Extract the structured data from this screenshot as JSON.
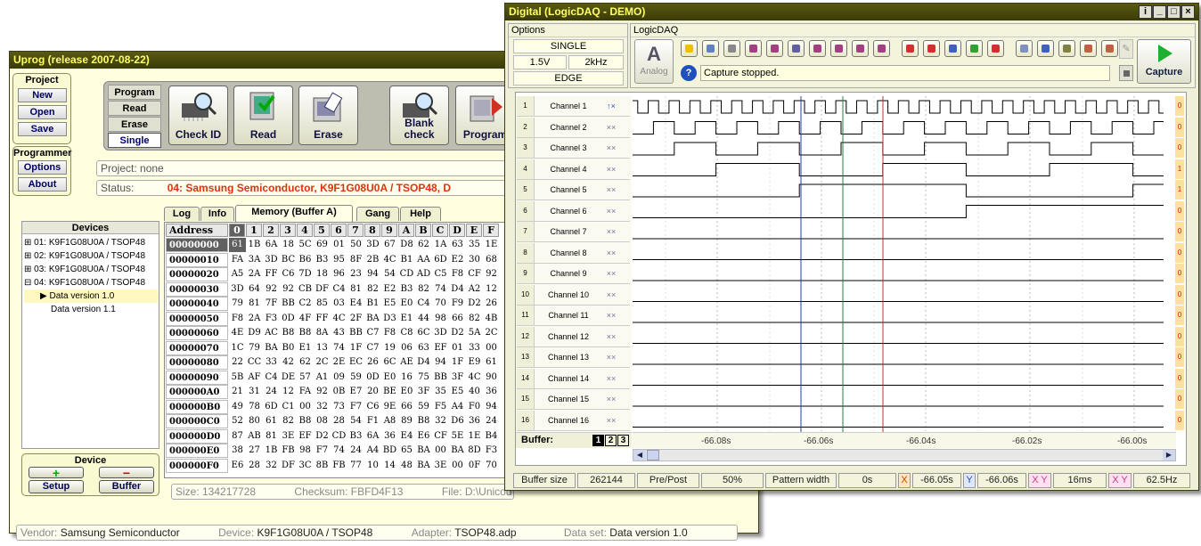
{
  "uprog": {
    "title": "Uprog (release 2007-08-22)",
    "project_group": "Project",
    "project_buttons": [
      "New",
      "Open",
      "Save"
    ],
    "programmer_group": "Programmer",
    "programmer_buttons": [
      "Options",
      "About"
    ],
    "mode_buttons": [
      "Program",
      "Read",
      "Erase",
      "Single"
    ],
    "big_buttons": [
      {
        "label": "Check ID",
        "icon": "chip-magnifier-icon"
      },
      {
        "label": "Read",
        "icon": "chip-read-icon"
      },
      {
        "label": "Erase",
        "icon": "chip-erase-icon"
      },
      {
        "label": "Blank check",
        "icon": "chip-blank-check-icon"
      },
      {
        "label": "Program",
        "icon": "chip-program-icon"
      }
    ],
    "project_field": "Project:  none",
    "status_label": "Status:",
    "status_value": "04: Samsung Semiconductor, K9F1G08U0A / TSOP48, D",
    "devices_title": "Devices",
    "devices": [
      "⊞ 01: K9F1G08U0A / TSOP48",
      "⊞ 02: K9F1G08U0A / TSOP48",
      "⊞ 03: K9F1G08U0A / TSOP48",
      "⊟ 04: K9F1G08U0A / TSOP48",
      "▶ Data version 1.0",
      "Data version 1.1"
    ],
    "tabs": [
      "Log",
      "Info",
      "Memory (Buffer A)",
      "Gang",
      "Help"
    ],
    "hex_header": [
      "Address",
      "0",
      "1",
      "2",
      "3",
      "4",
      "5",
      "6",
      "7",
      "8",
      "9",
      "A",
      "B",
      "C",
      "D",
      "E",
      "F"
    ],
    "hex_rows": [
      "00000000 61 1B 6A 18 5C 69 01 50 3D 67 D8 62 1A 63 35 1E",
      "00000010 FA 3A 3D BC B6 B3 95 8F 2B 4C B1 AA 6D E2 30 68",
      "00000020 A5 2A FF C6 7D 18 96 23 94 54 CD AD C5 F8 CF 92",
      "00000030 3D 64 92 92 CB DF C4 81 82 E2 B3 82 74 D4 A2 12",
      "00000040 79 81 7F BB C2 85 03 E4 B1 E5 E0 C4 70 F9 D2 26",
      "00000050 F8 2A F3 0D 4F FF 4C 2F BA D3 E1 44 98 66 82 4B",
      "00000060 4E D9 AC B8 B8 8A 43 BB C7 F8 C8 6C 3D D2 5A 2C",
      "00000070 1C 79 BA B0 E1 13 74 1F C7 19 06 63 EF 01 33 00",
      "00000080 22 CC 33 42 62 2C 2E EC 26 6C AE D4 94 1F E9 61",
      "00000090 5B AF C4 DE 57 A1 09 59 0D E0 16 75 BB 3F 4C 90",
      "000000A0 21 31 24 12 FA 92 0B E7 20 BE E0 3F 35 E5 40 36",
      "000000B0 49 78 6D C1 00 32 73 F7 C6 9E 66 59 F5 A4 F0 94",
      "000000C0 52 80 61 82 B8 08 28 54 F1 A8 89 B8 32 D6 36 24",
      "000000D0 87 AB 81 3E EF D2 CD B3 6A 36 E4 E6 CF 5E 1E B4",
      "000000E0 38 27 1B FB 98 F7 74 24 A4 BD 65 BA 00 BA 8D F3",
      "000000F0 E6 28 32 DF 3C 8B FB 77 10 14 48 BA 3E 00 0F 70"
    ],
    "device_group": "Device",
    "device_buttons": [
      "+",
      "−",
      "Setup",
      "Buffer"
    ],
    "size_text": "Size: 134217728",
    "checksum_text": "Checksum: FBFD4F13",
    "file_text": "File: D:\\Unicod",
    "footer": {
      "vendor_label": "Vendor:",
      "vendor": "Samsung Semiconductor",
      "device_label": "Device:",
      "device": "K9F1G08U0A / TSOP48",
      "adapter_label": "Adapter:",
      "adapter": "TSOP48.adp",
      "dataset_label": "Data set:",
      "dataset": "Data version 1.0"
    }
  },
  "daq": {
    "title": "Digital (LogicDAQ - DEMO)",
    "window_buttons": [
      "i",
      "_",
      "□",
      "×"
    ],
    "options_label": "Options",
    "mode": "SINGLE",
    "voltage": "1.5V",
    "rate": "2kHz",
    "trigger": "EDGE",
    "logicdaq_label": "LogicDAQ",
    "analog_label": "Analog",
    "analog_letter": "A",
    "status_message": "Capture stopped.",
    "capture_label": "Capture",
    "toolbar_icons": [
      "settings-icon",
      "save-icon",
      "print-icon",
      "tool1-icon",
      "tool2-icon",
      "tool3-icon",
      "tool4-icon",
      "tool5-icon",
      "tool6-icon",
      "tool7-icon",
      "red-marker-icon",
      "red-marker2-icon",
      "blue-marker-icon",
      "green-marker-icon",
      "red-marker3-icon",
      "grid-icon",
      "binary-icon",
      "find-icon",
      "cursor-icon",
      "pencil-icon"
    ],
    "channels": [
      {
        "num": "1",
        "name": "Channel 1",
        "trig": "↑×",
        "value": "0"
      },
      {
        "num": "2",
        "name": "Channel 2",
        "trig": "××",
        "value": "0"
      },
      {
        "num": "3",
        "name": "Channel 3",
        "trig": "××",
        "value": "0"
      },
      {
        "num": "4",
        "name": "Channel 4",
        "trig": "××",
        "value": "1"
      },
      {
        "num": "5",
        "name": "Channel 5",
        "trig": "××",
        "value": "1"
      },
      {
        "num": "6",
        "name": "Channel 6",
        "trig": "××",
        "value": "0"
      },
      {
        "num": "7",
        "name": "Channel 7",
        "trig": "××",
        "value": "0"
      },
      {
        "num": "8",
        "name": "Channel 8",
        "trig": "××",
        "value": "0"
      },
      {
        "num": "9",
        "name": "Channel 9",
        "trig": "××",
        "value": "0"
      },
      {
        "num": "10",
        "name": "Channel 10",
        "trig": "××",
        "value": "0"
      },
      {
        "num": "11",
        "name": "Channel 11",
        "trig": "××",
        "value": "0"
      },
      {
        "num": "12",
        "name": "Channel 12",
        "trig": "××",
        "value": "0"
      },
      {
        "num": "13",
        "name": "Channel 13",
        "trig": "××",
        "value": "0"
      },
      {
        "num": "14",
        "name": "Channel 14",
        "trig": "××",
        "value": "0"
      },
      {
        "num": "15",
        "name": "Channel 15",
        "trig": "××",
        "value": "0"
      },
      {
        "num": "16",
        "name": "Channel 16",
        "trig": "××",
        "value": "0"
      }
    ],
    "waveform_periods": [
      1,
      2,
      4,
      8,
      16,
      32,
      64
    ],
    "buffer_label": "Buffer:",
    "buffer_buttons": [
      "1",
      "2",
      "3"
    ],
    "time_labels": [
      "-66.08s",
      "-66.06s",
      "-66.04s",
      "-66.02s",
      "-66.00s"
    ],
    "statusbar": {
      "buffer_size_label": "Buffer size",
      "buffer_size": "262144",
      "prepost_label": "Pre/Post",
      "prepost": "50%",
      "pattern_label": "Pattern width",
      "pattern": "0s",
      "x_label": "X",
      "x_value": "-66.05s",
      "y_label": "Y",
      "y_value": "-66.06s",
      "xy_label": "X Y",
      "xy_value": "16ms",
      "xy2_label": "X Y",
      "xy2_value": "62.5Hz"
    }
  }
}
